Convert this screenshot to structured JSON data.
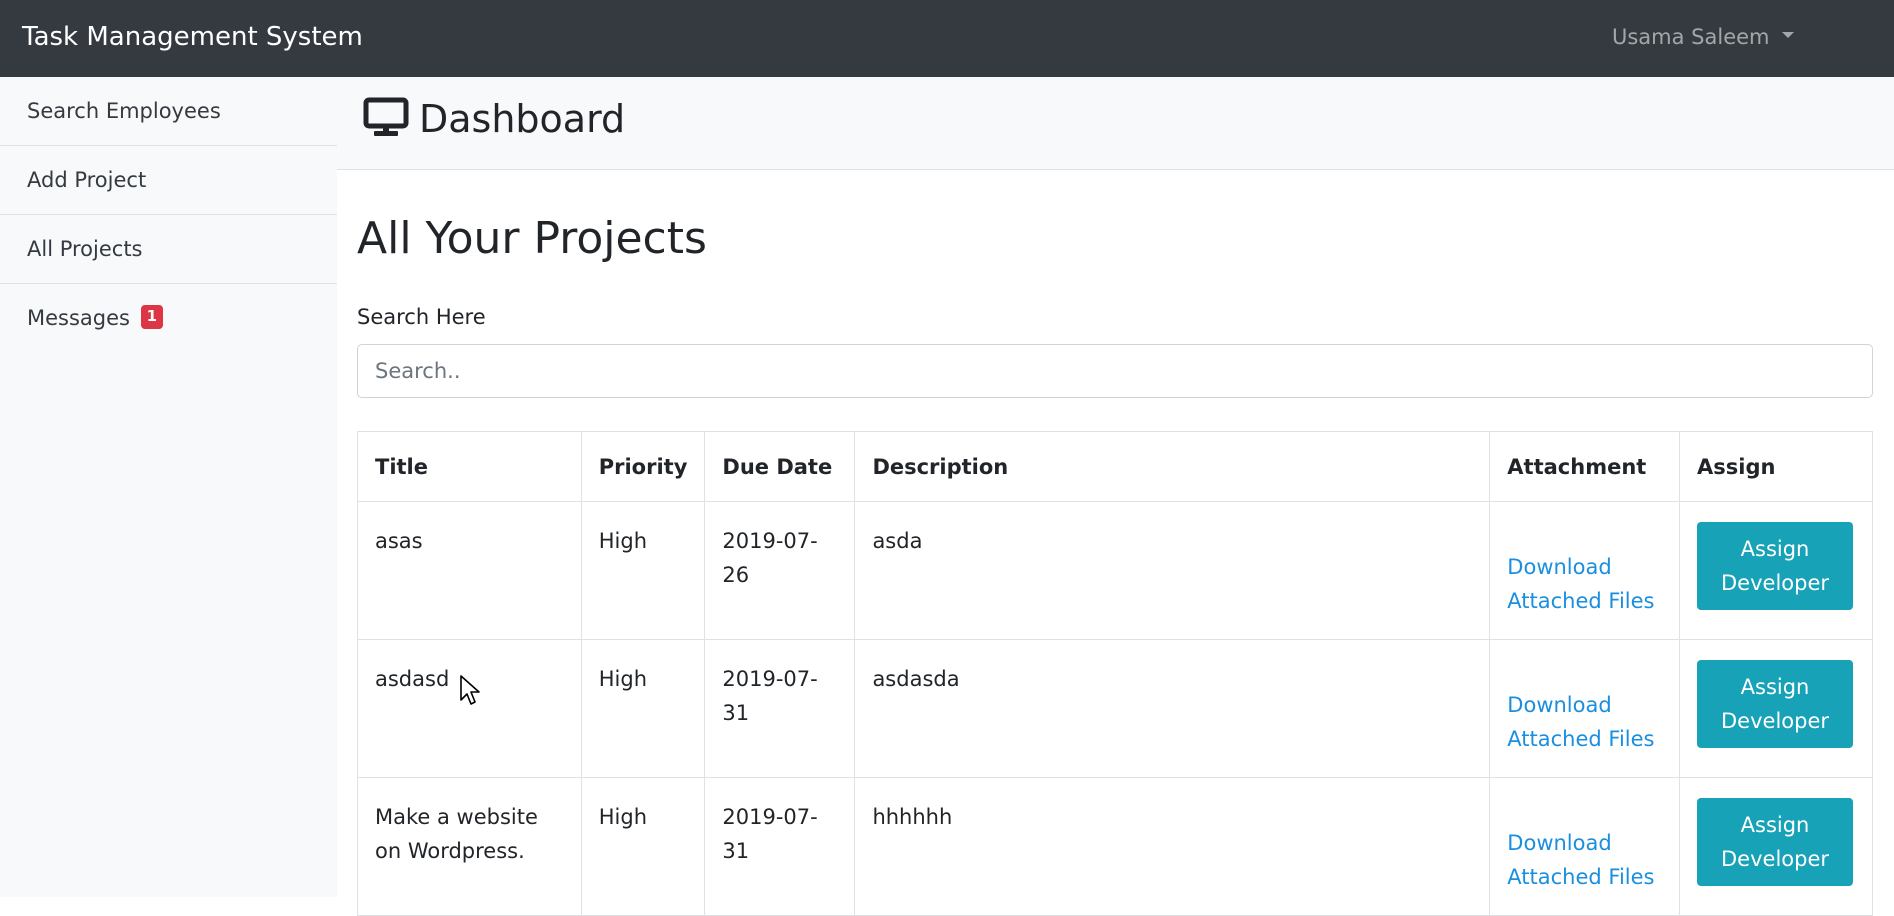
{
  "app": {
    "brand": "Task Management System",
    "user_name": "Usama Saleem"
  },
  "sidebar": {
    "items": [
      {
        "label": "Search Employees"
      },
      {
        "label": "Add Project"
      },
      {
        "label": "All Projects"
      },
      {
        "label": "Messages",
        "badge": "1"
      }
    ]
  },
  "header": {
    "icon": "desktop-monitor-icon",
    "title": "Dashboard"
  },
  "main": {
    "heading": "All Your Projects",
    "search_label": "Search Here",
    "search_placeholder": "Search..",
    "search_value": ""
  },
  "table": {
    "columns": [
      "Title",
      "Priority",
      "Due Date",
      "Description",
      "Attachment",
      "Assign"
    ],
    "rows": [
      {
        "title": "asas",
        "priority": "High",
        "due_date": "2019-07-26",
        "description": "asda",
        "attachment_line1": "Download",
        "attachment_line2": "Attached Files",
        "assign_line1": "Assign",
        "assign_line2": "Developer"
      },
      {
        "title": "asdasd",
        "priority": "High",
        "due_date": "2019-07-31",
        "description": "asdasda",
        "attachment_line1": "Download",
        "attachment_line2": "Attached Files",
        "assign_line1": "Assign",
        "assign_line2": "Developer"
      },
      {
        "title": "Make a website on Wordpress.",
        "priority": "High",
        "due_date": "2019-07-31",
        "description": "hhhhhh",
        "attachment_line1": "Download",
        "attachment_line2": "Attached Files",
        "assign_line1": "Assign",
        "assign_line2": "Developer"
      }
    ]
  },
  "colors": {
    "navbar": "#343a40",
    "sidebar": "#f8f9fa",
    "badge": "#dc3545",
    "link": "#1a8fe0",
    "button": "#17a2b8"
  }
}
